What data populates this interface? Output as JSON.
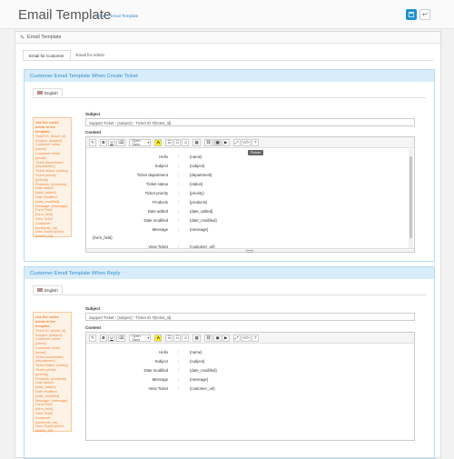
{
  "header": {
    "title": "Email Template",
    "breadcrumb": [
      "Home",
      "Email Template"
    ],
    "save_icon": "save-icon",
    "back_icon": "reply-icon"
  },
  "panel": {
    "heading": "Email Template",
    "tabs": [
      "Email for Customer",
      "Email for Admin"
    ]
  },
  "sections": [
    {
      "title": "Customer Email Template When Create Ticket",
      "language": "English",
      "codes": [
        "Use the codes below in the template:",
        "Ticket ID: {ticket_id}",
        "Subject: {subject}",
        "Customer name: {name}",
        "Customer email: {email}",
        "Ticket department:",
        "{department}",
        "Ticket status: {status}",
        "Ticket priority: {priority}",
        "Products: {products}",
        "Date added: {date_added}",
        "Date modified:",
        "{date_modified}",
        "Message: {message}",
        "Form Field: {form_field}",
        "View Ticket Customer:",
        "{customer_url}",
        "View Ticket Admin:",
        "{admin_url}"
      ],
      "subject_label": "Subject",
      "subject_value": "Support Ticket - {subject} - Ticket ID #{ticket_id}",
      "content_label": "Content",
      "font_name": "Open Sans",
      "tooltip": "Picture",
      "fields": [
        {
          "label": "Hello",
          "value": "{name}"
        },
        {
          "label": "Subject",
          "value": "{subject}"
        },
        {
          "label": "Ticket department",
          "value": "{department}"
        },
        {
          "label": "Ticket status",
          "value": "{status}"
        },
        {
          "label": "Ticket priority",
          "value": "{priority}"
        },
        {
          "label": "Products",
          "value": "{products}"
        },
        {
          "label": "Date added",
          "value": "{date_added}"
        },
        {
          "label": "Date modified",
          "value": "{date_modified}"
        },
        {
          "label": "Message",
          "value": "{message}"
        },
        {
          "label": "View Ticket",
          "value": "{customer_url}"
        }
      ],
      "form_field": "{form_field}"
    },
    {
      "title": "Customer Email Template When Reply",
      "language": "English",
      "codes": [
        "Use the codes below in the template:",
        "Ticket ID: {ticket_id}",
        "Subject: {subject}",
        "Customer name: {name}",
        "Customer email: {email}",
        "Ticket department:",
        "{department}",
        "Ticket status: {status}",
        "Ticket priority: {priority}",
        "Products: {products}",
        "Date added: {date_added}",
        "Date modified:",
        "{date_modified}",
        "Message: {message}",
        "Form Field: {form_field}",
        "View Ticket Customer:",
        "{customer_url}",
        "View Ticket Admin:",
        "{admin_url}"
      ],
      "subject_label": "Subject",
      "subject_value": "Support Ticket - {subject} - Ticket ID #{ticket_id}",
      "content_label": "Content",
      "font_name": "Open Sans",
      "fields": [
        {
          "label": "Hello",
          "value": "{name}"
        },
        {
          "label": "Subject",
          "value": "{subject}"
        },
        {
          "label": "Date modified",
          "value": "{date_modified}"
        },
        {
          "label": "Message",
          "value": "{message}"
        },
        {
          "label": "View Ticket",
          "value": "{customer_url}"
        }
      ]
    }
  ],
  "toolbar": {
    "style": "✎",
    "bold": "B",
    "underline": "U",
    "clear": "⌫",
    "color": "A",
    "ul": "☰",
    "ol": "☷",
    "align": "≡",
    "table": "▦",
    "link": "⛓",
    "picture": "▣",
    "video": "▶",
    "fullscreen": "⤢",
    "code": "</>",
    "help": "?"
  }
}
